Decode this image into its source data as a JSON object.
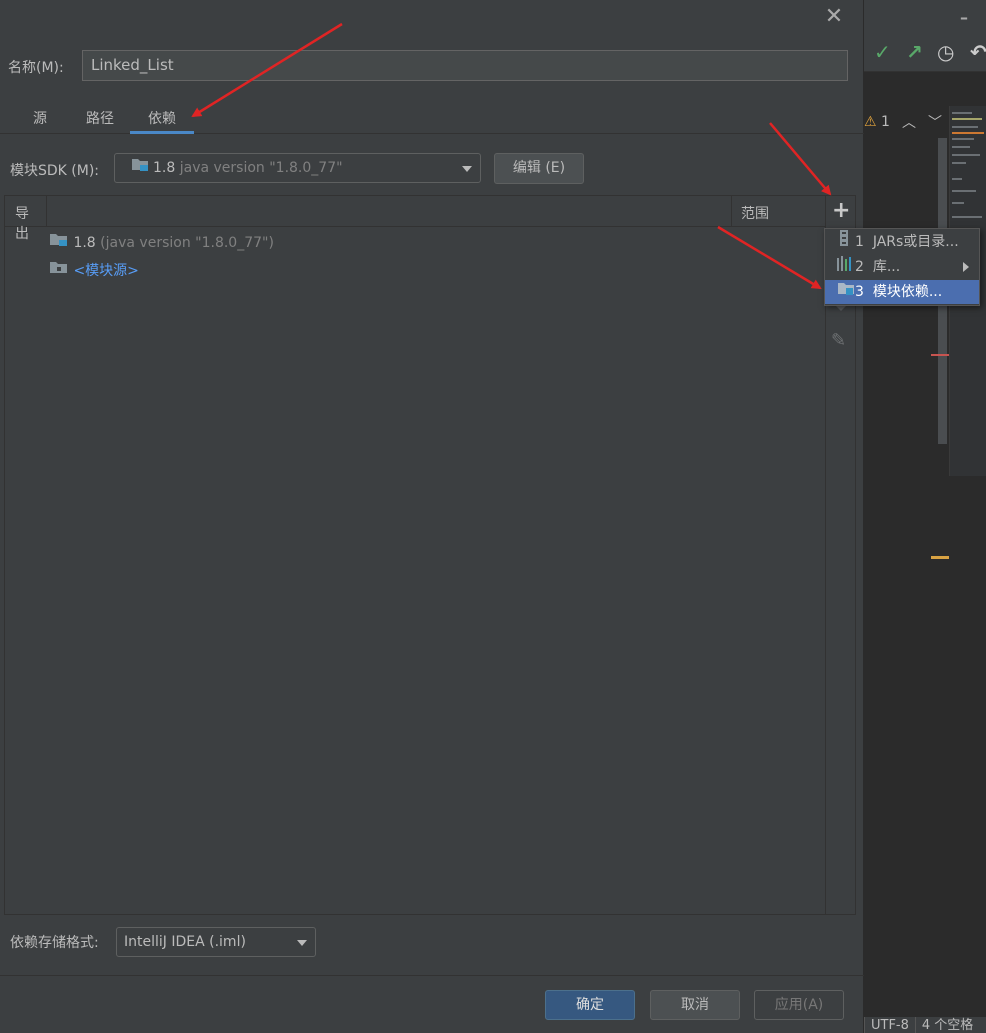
{
  "dialog": {
    "name_label": "名称(M):",
    "name_value": "Linked_List",
    "tabs": [
      {
        "label": "源",
        "active": false
      },
      {
        "label": "路径",
        "active": false
      },
      {
        "label": "依赖",
        "active": true
      }
    ],
    "sdk_label": "模块SDK (M):",
    "sdk_version": "1.8",
    "sdk_detail": "java version \"1.8.0_77\"",
    "edit_button": "编辑 (E)",
    "table": {
      "col_export": "导出",
      "col_scope": "范围",
      "rows": [
        {
          "name": "1.8",
          "detail": "(java version \"1.8.0_77\")"
        },
        {
          "name": "<模块源>"
        }
      ]
    },
    "storage_label": "依赖存储格式:",
    "storage_value": "IntelliJ IDEA (.iml)",
    "ok_button": "确定",
    "cancel_button": "取消",
    "apply_button": "应用(A)"
  },
  "add_menu": {
    "items": [
      {
        "num": "1",
        "label": "JARs或目录...",
        "icon": "jar-icon"
      },
      {
        "num": "2",
        "label": "库...",
        "icon": "library-icon",
        "submenu": true
      },
      {
        "num": "3",
        "label": "模块依赖...",
        "icon": "module-icon",
        "selected": true
      }
    ]
  },
  "editor": {
    "warning_count": "1",
    "status_encoding": "UTF-8",
    "status_indent": "4 个空格"
  },
  "colors": {
    "accent": "#4b6eaf",
    "annotation_arrow": "#e02424",
    "link": "#589df6"
  }
}
